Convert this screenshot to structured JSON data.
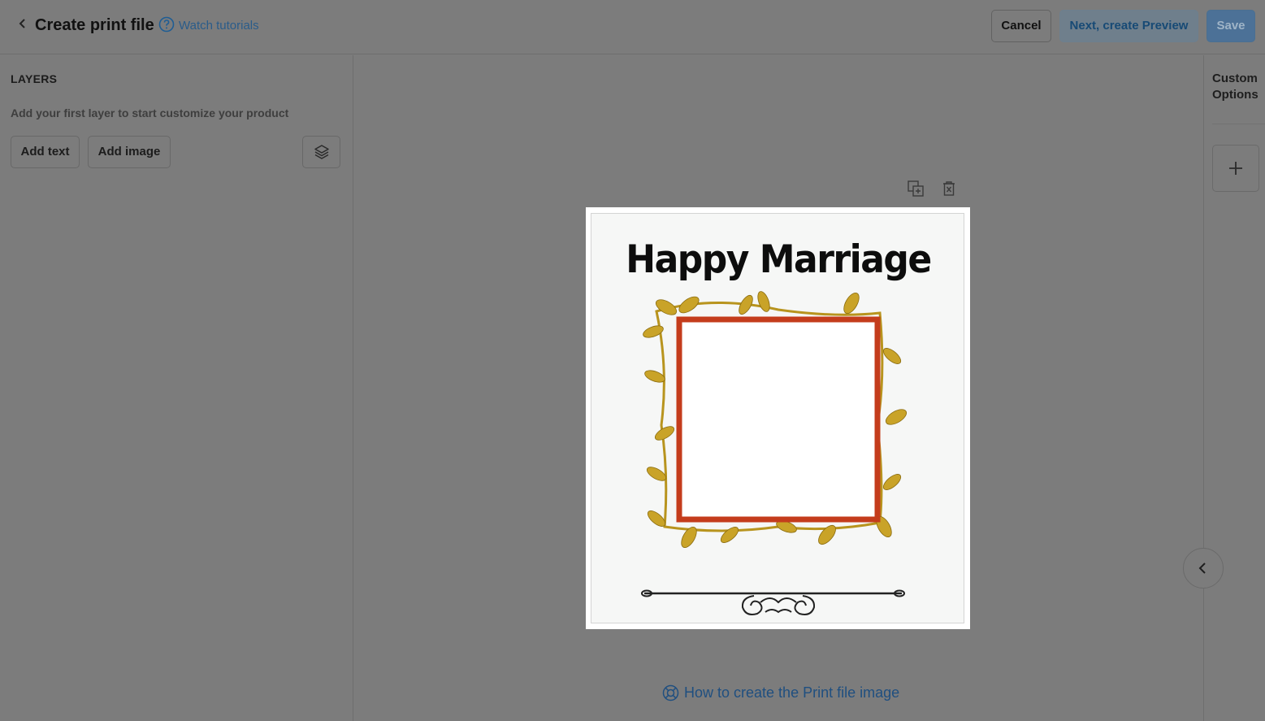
{
  "header": {
    "title": "Create print file",
    "tutorial_link": "Watch tutorials",
    "cancel_label": "Cancel",
    "next_label": "Next, create Preview",
    "save_label": "Save"
  },
  "layers_panel": {
    "heading": "LAYERS",
    "hint": "Add your first layer to start customize your product",
    "add_text_label": "Add text",
    "add_image_label": "Add image"
  },
  "canvas": {
    "print_heading": "Happy Marriage",
    "guide_link": "How to create the Print file image"
  },
  "right_panel": {
    "title": "Custom Options"
  },
  "colors": {
    "overlay": "#7c7c7c",
    "link": "#1f4f80",
    "primary_button": "#4c7197",
    "frame_border": "#c43c1c",
    "leaf": "#c9a328"
  },
  "icons": [
    "chevron-left-icon",
    "help-circle-icon",
    "layers-icon",
    "duplicate-icon",
    "delete-icon",
    "lifebuoy-icon",
    "plus-icon",
    "chevron-left-icon"
  ]
}
